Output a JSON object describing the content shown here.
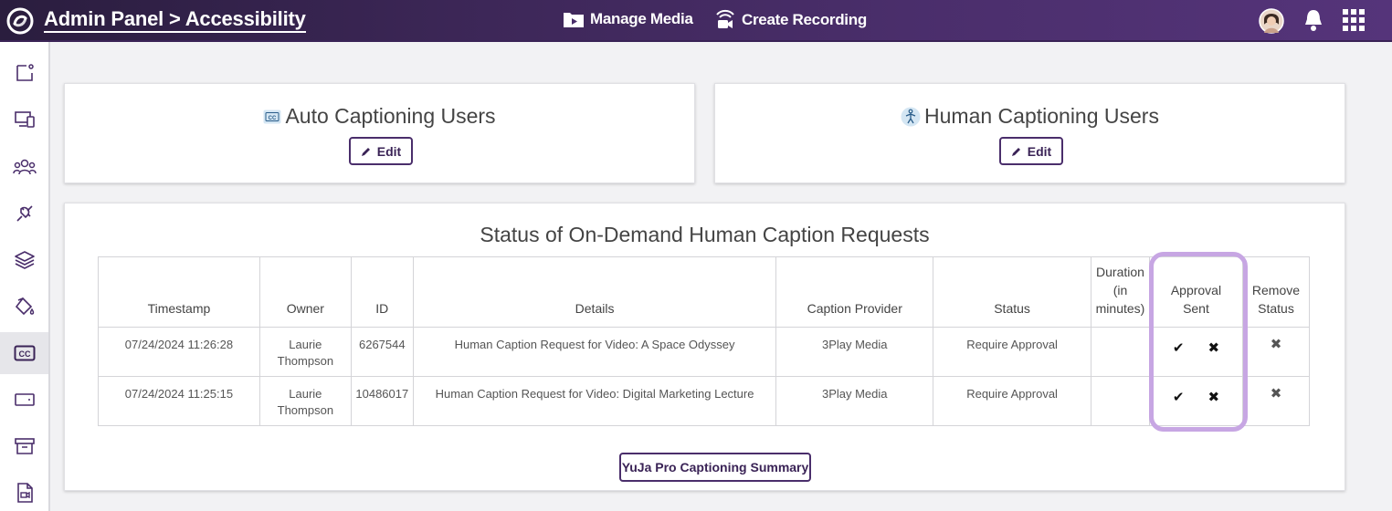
{
  "header": {
    "breadcrumb_root": "Admin Panel",
    "breadcrumb_sep": ">",
    "breadcrumb_current": "Accessibility",
    "manage_media_label": "Manage Media",
    "create_recording_label": "Create Recording"
  },
  "auto_card": {
    "title": "Auto Captioning Users",
    "edit_label": "Edit"
  },
  "human_card": {
    "title": "Human Captioning Users",
    "edit_label": "Edit"
  },
  "requests": {
    "title": "Status of On-Demand Human Caption Requests",
    "columns": {
      "timestamp": "Timestamp",
      "owner": "Owner",
      "id": "ID",
      "details": "Details",
      "provider": "Caption Provider",
      "status": "Status",
      "duration": "Duration (in minutes)",
      "approval": "Approval Sent",
      "remove": "Remove Status"
    },
    "rows": [
      {
        "timestamp": "07/24/2024 11:26:28",
        "owner": "Laurie Thompson",
        "id": "6267544",
        "details": "Human Caption Request for Video: A Space Odyssey",
        "provider": "3Play Media",
        "status": "Require Approval",
        "duration": ""
      },
      {
        "timestamp": "07/24/2024 11:25:15",
        "owner": "Laurie Thompson",
        "id": "10486017",
        "details": "Human Caption Request for Video: Digital Marketing Lecture",
        "provider": "3Play Media",
        "status": "Require Approval",
        "duration": ""
      }
    ],
    "summary_button": "YuJa Pro Captioning Summary"
  },
  "colors": {
    "brand": "#4a2e6b",
    "highlight": "#c7a6e3"
  }
}
